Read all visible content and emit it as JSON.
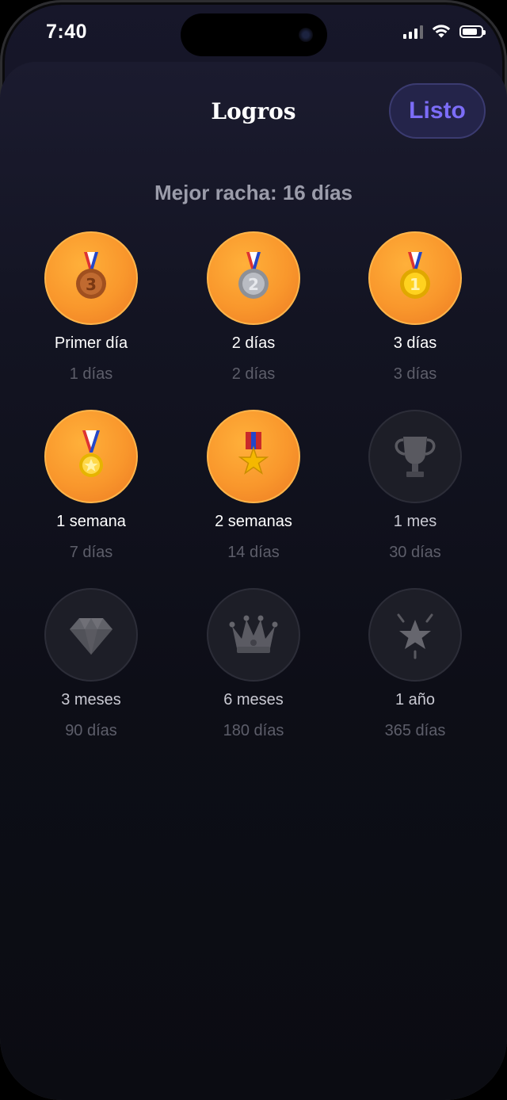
{
  "status_bar": {
    "time": "7:40"
  },
  "header": {
    "title": "Logros",
    "done_label": "Listo"
  },
  "best_streak_text": "Mejor racha: 16 días",
  "achievements": [
    {
      "label": "Primer día",
      "days": "1 días",
      "unlocked": true,
      "icon": "bronze-medal-icon"
    },
    {
      "label": "2 días",
      "days": "2 días",
      "unlocked": true,
      "icon": "silver-medal-icon"
    },
    {
      "label": "3 días",
      "days": "3 días",
      "unlocked": true,
      "icon": "gold-medal-icon"
    },
    {
      "label": "1 semana",
      "days": "7 días",
      "unlocked": true,
      "icon": "sports-medal-icon"
    },
    {
      "label": "2 semanas",
      "days": "14 días",
      "unlocked": true,
      "icon": "military-medal-icon"
    },
    {
      "label": "1 mes",
      "days": "30 días",
      "unlocked": false,
      "icon": "trophy-icon"
    },
    {
      "label": "3 meses",
      "days": "90 días",
      "unlocked": false,
      "icon": "diamond-icon"
    },
    {
      "label": "6 meses",
      "days": "180 días",
      "unlocked": false,
      "icon": "crown-icon"
    },
    {
      "label": "1 año",
      "days": "365 días",
      "unlocked": false,
      "icon": "glowing-star-icon"
    }
  ],
  "colors": {
    "accent": "#7c6df7",
    "badge_orange": "#f9972c",
    "background": "#0d0e17"
  }
}
